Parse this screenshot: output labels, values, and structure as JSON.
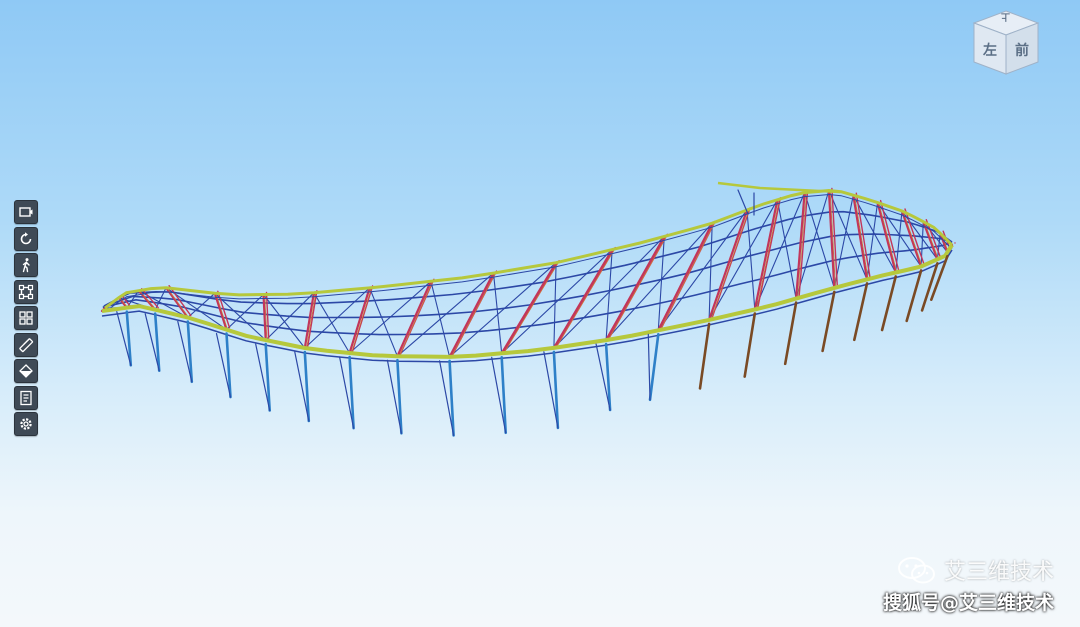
{
  "toolbar": {
    "tools": [
      {
        "icon": "camera-icon"
      },
      {
        "icon": "rotate-icon"
      },
      {
        "icon": "walk-icon"
      },
      {
        "icon": "fit-view-icon"
      },
      {
        "icon": "model-tree-icon"
      },
      {
        "icon": "measure-icon"
      },
      {
        "icon": "section-icon"
      },
      {
        "icon": "properties-icon"
      },
      {
        "icon": "settings-icon"
      }
    ]
  },
  "navcube": {
    "top_label": "上",
    "left_label": "左",
    "front_label": "前"
  },
  "watermark": {
    "line1": "艾三维技术",
    "line2": "搜狐号@艾三维技术",
    "icon": "wechat-icon"
  },
  "colors": {
    "chord_yellow_green": "#b6c83c",
    "truss_red": "#c2365a",
    "member_blue": "#2c48a6",
    "column_blue": "#2e80c8",
    "column_brown": "#7a4a24",
    "bracing_orange": "#d6842c",
    "sky_top": "#8fc9f5",
    "sky_bottom": "#f4f8fb"
  }
}
